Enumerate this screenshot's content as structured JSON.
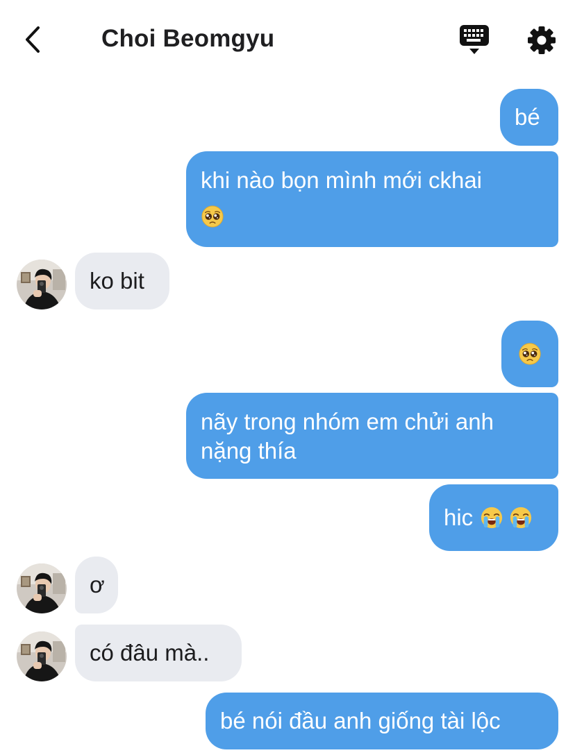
{
  "header": {
    "back_icon": "chevron-left-icon",
    "title": "Choi Beomgyu",
    "keyboard_icon": "keyboard-icon",
    "settings_icon": "gear-icon"
  },
  "colors": {
    "sent_bubble": "#4f9ee8",
    "received_bubble": "#e9ebf0",
    "text_dark": "#1c1c1e"
  },
  "messages": [
    {
      "side": "sent",
      "text": "bé"
    },
    {
      "side": "sent",
      "line1": "khi nào bọn mình mới ckhai",
      "emoji": "pleading-face"
    },
    {
      "side": "received",
      "text": "ko bit"
    },
    {
      "side": "sent",
      "emoji": "pleading-face"
    },
    {
      "side": "sent",
      "line1": "nãy trong nhóm em chửi anh",
      "line2": "nặng thía"
    },
    {
      "side": "sent",
      "text": "hic",
      "emojis": [
        "loudly-crying-face",
        "loudly-crying-face"
      ]
    },
    {
      "side": "received",
      "text": "ơ"
    },
    {
      "side": "received",
      "text": "có đâu mà.."
    },
    {
      "side": "sent",
      "text": "bé nói đầu anh giống tài lộc"
    }
  ]
}
